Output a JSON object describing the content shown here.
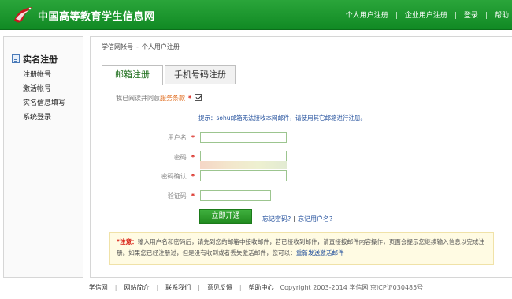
{
  "header": {
    "site_title": "中国高等教育学生信息网",
    "nav": [
      "个人用户注册",
      "企业用户注册",
      "登录",
      "帮助"
    ]
  },
  "sidebar": {
    "title": "实名注册",
    "items": [
      "注册帐号",
      "激活帐号",
      "实名信息填写",
      "系统登录"
    ]
  },
  "breadcrumb": {
    "root": "学信网帐号",
    "separator": "-",
    "current": "个人用户注册"
  },
  "tabs": [
    "邮箱注册",
    "手机号码注册"
  ],
  "form": {
    "agree_text": "我已阅读并同意",
    "agree_link": "服务条款",
    "agree_checked": true,
    "tip": "提示：sohu邮箱无法接收本网邮件，请使用其它邮箱进行注册。",
    "fields": {
      "username_label": "用户名",
      "password_label": "密码",
      "confirm_label": "密码确认",
      "captcha_label": "验证码"
    },
    "values": {
      "username": "",
      "password": "",
      "confirm": "",
      "captcha": ""
    },
    "submit_label": "立即开通",
    "forgot_password": "忘记密码?",
    "link_separator": "|",
    "forgot_username": "忘记用户名?"
  },
  "notice": {
    "prefix": "*注意：",
    "body": "输入用户名和密码后，请先到您的邮箱中接收邮件，若已接收到邮件，请直接按邮件内容操作，页面会提示您继续输入信息以完成注册。如果您已经注册过，但是没有收到或者丢失激活邮件，您可以：",
    "resend_link": "重新发送激活邮件"
  },
  "footer": {
    "links": [
      "学信网",
      "网站简介",
      "联系我们",
      "意见反馈",
      "帮助中心"
    ],
    "copyright": "Copyright 2003-2014 学信网 京ICP证030485号"
  },
  "colors": {
    "header_green": "#1f9a30",
    "tab_active_text": "#1d6e1b",
    "required_star": "#d6160c",
    "link_blue": "#1f4d9b",
    "terms_orange": "#e06a1b",
    "notice_bg": "#fffbe3"
  },
  "icons": {
    "logo": "bird-logo-icon",
    "sidebar_title": "document-icon",
    "checkbox": "checkmark-icon"
  }
}
